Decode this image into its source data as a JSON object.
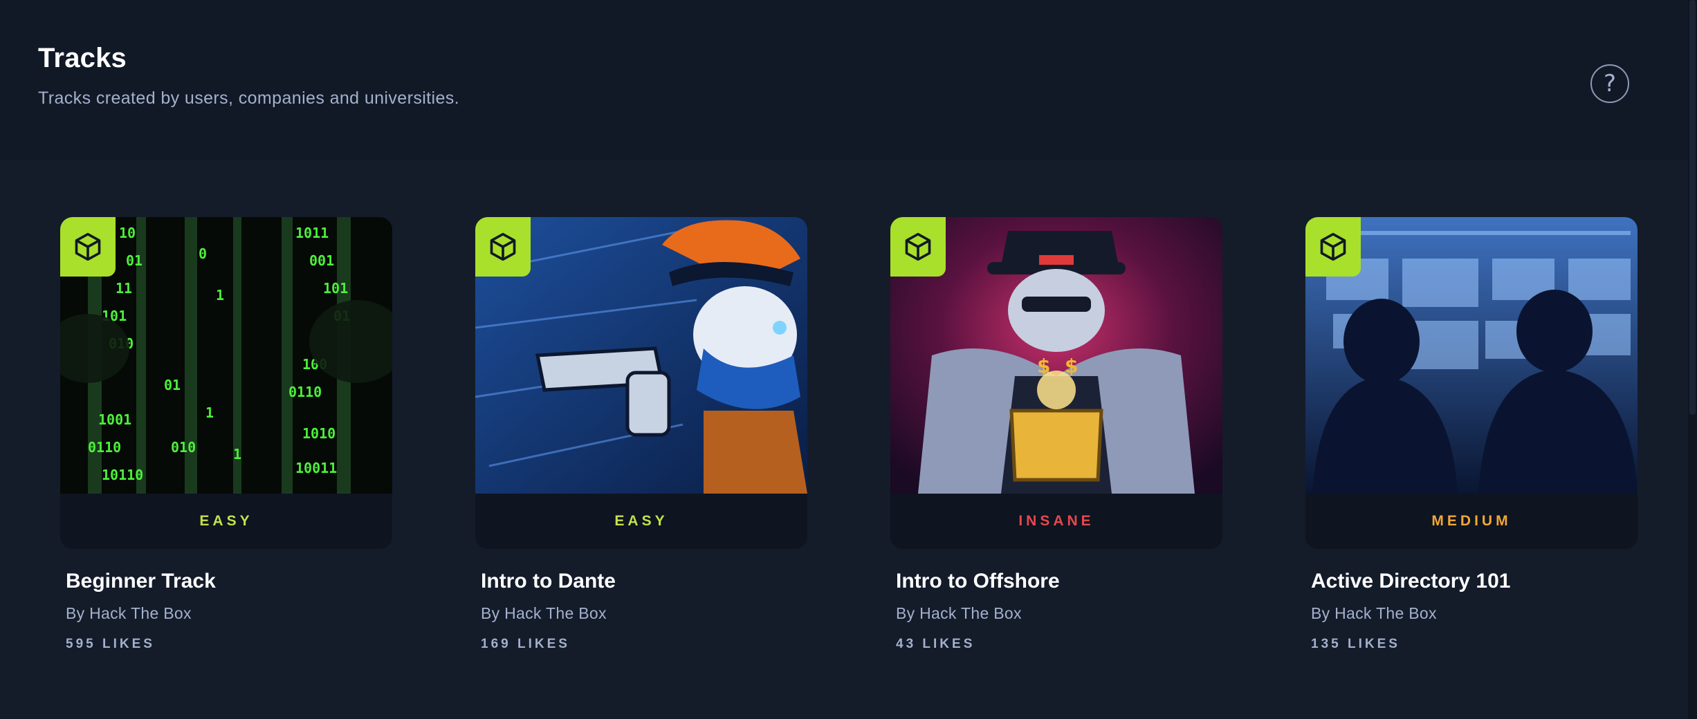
{
  "header": {
    "title": "Tracks",
    "subtitle": "Tracks created by users, companies and universities.",
    "help_glyph": "?"
  },
  "icons": {
    "badge": "cube-icon",
    "help": "question-circle-icon"
  },
  "colors": {
    "accent": "#a9e02b",
    "easy": "#c6e04b",
    "medium": "#f1a835",
    "insane": "#e5484d",
    "background": "#141c2a",
    "header_background": "#111927"
  },
  "tracks": [
    {
      "title": "Beginner Track",
      "author": "By Hack The Box",
      "likes": "595 LIKES",
      "difficulty": "EASY",
      "difficulty_color": "#c6e04b",
      "image": "green-binary-matrix-illustration"
    },
    {
      "title": "Intro to Dante",
      "author": "By Hack The Box",
      "likes": "169 LIKES",
      "difficulty": "EASY",
      "difficulty_color": "#c6e04b",
      "image": "cowboy-gunslinger-illustration"
    },
    {
      "title": "Intro to Offshore",
      "author": "By Hack The Box",
      "likes": "43 LIKES",
      "difficulty": "INSANE",
      "difficulty_color": "#e5484d",
      "image": "mobster-treasure-chest-illustration"
    },
    {
      "title": "Active Directory 101",
      "author": "By Hack The Box",
      "likes": "135 LIKES",
      "difficulty": "MEDIUM",
      "difficulty_color": "#f1a835",
      "image": "analysts-at-monitors-illustration"
    }
  ]
}
